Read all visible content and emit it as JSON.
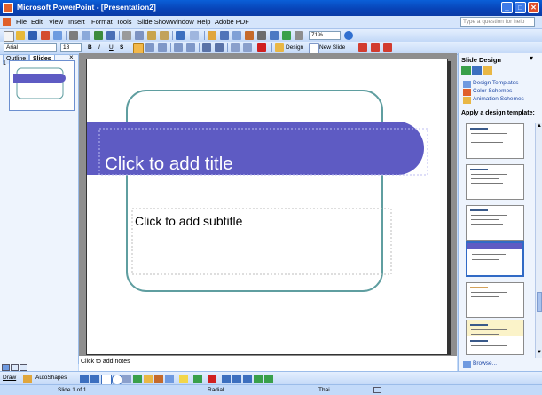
{
  "window": {
    "title": "Microsoft PowerPoint - [Presentation2]"
  },
  "menubar": {
    "items": [
      "File",
      "Edit",
      "View",
      "Insert",
      "Format",
      "Tools",
      "Slide Show",
      "Window",
      "Help",
      "Adobe PDF"
    ]
  },
  "help_box": {
    "placeholder": "Type a question for help"
  },
  "standard_toolbar": {
    "zoom": "71%"
  },
  "formatting_toolbar": {
    "font": "Arial",
    "font_size": "18",
    "bold": "B",
    "italic": "I",
    "underline": "U",
    "shadow": "S",
    "design_label": "Design",
    "new_slide_label": "New Slide"
  },
  "left_pane": {
    "tabs": [
      "Outline",
      "Slides"
    ],
    "close": "×",
    "slide_number": "1"
  },
  "slide": {
    "title_placeholder": "Click to add title",
    "subtitle_placeholder": "Click to add subtitle"
  },
  "notes": {
    "placeholder": "Click to add notes"
  },
  "task_pane": {
    "title": "Slide Design",
    "links": [
      "Design Templates",
      "Color Schemes",
      "Animation Schemes"
    ],
    "apply_heading": "Apply a design template:",
    "browse_label": "Browse...",
    "scroll_up": "▲",
    "scroll_down": "▼"
  },
  "drawing_toolbar": {
    "draw_label": "Draw",
    "autoshapes_label": "AutoShapes"
  },
  "statusbar": {
    "slide": "Slide 1 of 1",
    "design": "Radial",
    "language": "Thai"
  },
  "colors": {
    "title_band": "#5e5bc3",
    "frame": "#5f9ea0",
    "titlebar": "#0a50c8",
    "chrome": "#c3daf9"
  }
}
